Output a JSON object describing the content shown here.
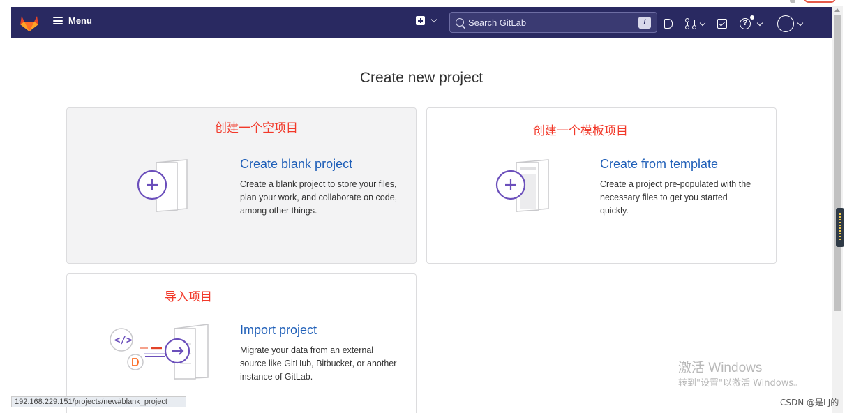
{
  "navbar": {
    "menu_label": "Menu",
    "search_placeholder": "Search GitLab",
    "search_shortcut": "/",
    "help_glyph": "?",
    "icons": [
      "gitlab-logo",
      "hamburger-icon",
      "plus-square-icon",
      "chevron-down-icon",
      "search-icon",
      "issues-icon",
      "merge-request-icon",
      "todo-icon",
      "help-icon",
      "avatar-icon"
    ],
    "bg_color": "#292961"
  },
  "page": {
    "title": "Create new project"
  },
  "cards": {
    "blank": {
      "annotation": "创建一个空项目",
      "title": "Create blank project",
      "description": "Create a blank project to store your files, plan your work, and collaborate on code, among other things."
    },
    "template": {
      "annotation": "创建一个模板项目",
      "title": "Create from template",
      "description": "Create a project pre-populated with the necessary files to get you started quickly."
    },
    "import": {
      "annotation": "导入项目",
      "title": "Import project",
      "description": "Migrate your data from an external source like GitHub, Bitbucket, or another instance of GitLab."
    }
  },
  "status_bar": {
    "url": "192.168.229.151/projects/new#blank_project"
  },
  "overlay": {
    "activate_line1": "激活 Windows",
    "activate_line2": "转到\"设置\"以激活 Windows。",
    "csdn": "CSDN @是LJ的"
  },
  "colors": {
    "link": "#1f5fb8",
    "annotation": "#f2392a",
    "accent": "#6b4fbb"
  }
}
